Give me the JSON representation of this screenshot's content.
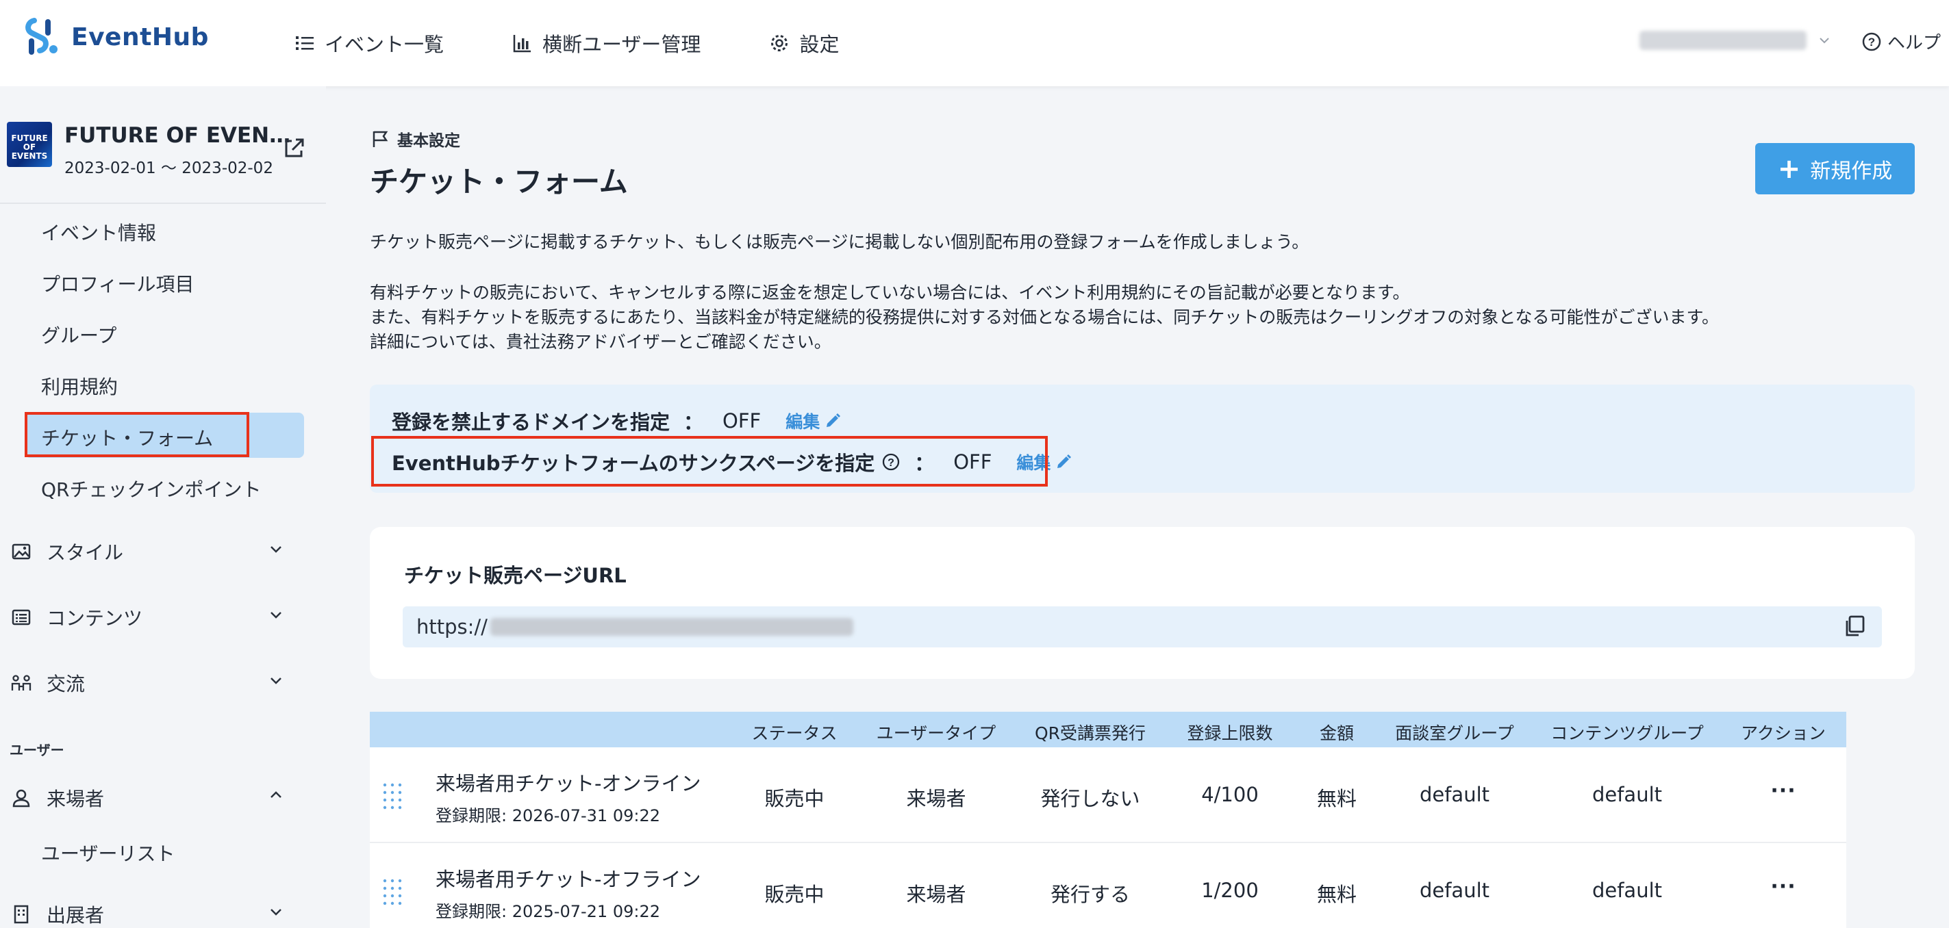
{
  "app": {
    "name": "EventHub",
    "brand_color": "#1d4e94",
    "accent_color": "#3f9fe6",
    "highlight_color": "#e8321b"
  },
  "topnav": {
    "items": [
      {
        "label": "イベント一覧",
        "icon": "list-icon"
      },
      {
        "label": "横断ユーザー管理",
        "icon": "bar-chart-icon"
      },
      {
        "label": "設定",
        "icon": "gear-icon"
      }
    ],
    "help_label": "ヘルプ"
  },
  "event": {
    "thumb_text": "FUTURE OF EVENTS",
    "title": "FUTURE OF EVEN…",
    "dates": "2023-02-01 〜 2023-02-02"
  },
  "sidebar": {
    "items": [
      {
        "label": "イベント情報"
      },
      {
        "label": "プロフィール項目"
      },
      {
        "label": "グループ"
      },
      {
        "label": "利用規約"
      },
      {
        "label": "チケット・フォーム",
        "active": true
      },
      {
        "label": "QRチェックインポイント"
      }
    ],
    "groups": [
      {
        "label": "スタイル",
        "icon": "image-icon",
        "expanded": false
      },
      {
        "label": "コンテンツ",
        "icon": "contents-icon",
        "expanded": false
      },
      {
        "label": "交流",
        "icon": "networking-icon",
        "expanded": false
      }
    ],
    "section_label": "ユーザー",
    "user_groups": [
      {
        "label": "来場者",
        "icon": "user-icon",
        "expanded": true,
        "children": [
          {
            "label": "ユーザーリスト"
          }
        ]
      },
      {
        "label": "出展者",
        "icon": "building-icon",
        "expanded": false
      }
    ]
  },
  "main": {
    "breadcrumb": "基本設定",
    "title": "チケット・フォーム",
    "new_button": "新規作成",
    "description": [
      "チケット販売ページに掲載するチケット、もしくは販売ページに掲載しない個別配布用の登録フォームを作成しましょう。",
      "有料チケットの販売において、キャンセルする際に返金を想定していない場合には、イベント利用規約にその旨記載が必要となります。",
      "また、有料チケットを販売するにあたり、当該料金が特定継続的役務提供に対する対価となる場合には、同チケットの販売はクーリングオフの対象となる可能性がございます。",
      "詳細については、貴社法務アドバイザーとご確認ください。"
    ],
    "settings": [
      {
        "label": "登録を禁止するドメインを指定",
        "colon": "：",
        "value": "OFF",
        "edit": "編集"
      },
      {
        "label": "EventHubチケットフォームのサンクスページを指定",
        "colon": "：",
        "value": "OFF",
        "edit": "編集"
      }
    ],
    "url_card": {
      "title": "チケット販売ページURL",
      "url_prefix": "https://"
    }
  },
  "table": {
    "headers": [
      "ステータス",
      "ユーザータイプ",
      "QR受講票発行",
      "登録上限数",
      "金額",
      "面談室グループ",
      "コンテンツグループ",
      "アクション"
    ],
    "rows": [
      {
        "name": "来場者用チケット-オンライン",
        "deadline": "登録期限: 2026-07-31 09:22",
        "status": "販売中",
        "user_type": "来場者",
        "qr": "発行しない",
        "limit": "4/100",
        "price": "無料",
        "meeting_group": "default",
        "content_group": "default",
        "action": "···"
      },
      {
        "name": "来場者用チケット-オフライン",
        "deadline": "登録期限: 2025-07-21 09:22",
        "status": "販売中",
        "user_type": "来場者",
        "qr": "発行する",
        "limit": "1/200",
        "price": "無料",
        "meeting_group": "default",
        "content_group": "default",
        "action": "···"
      }
    ]
  }
}
